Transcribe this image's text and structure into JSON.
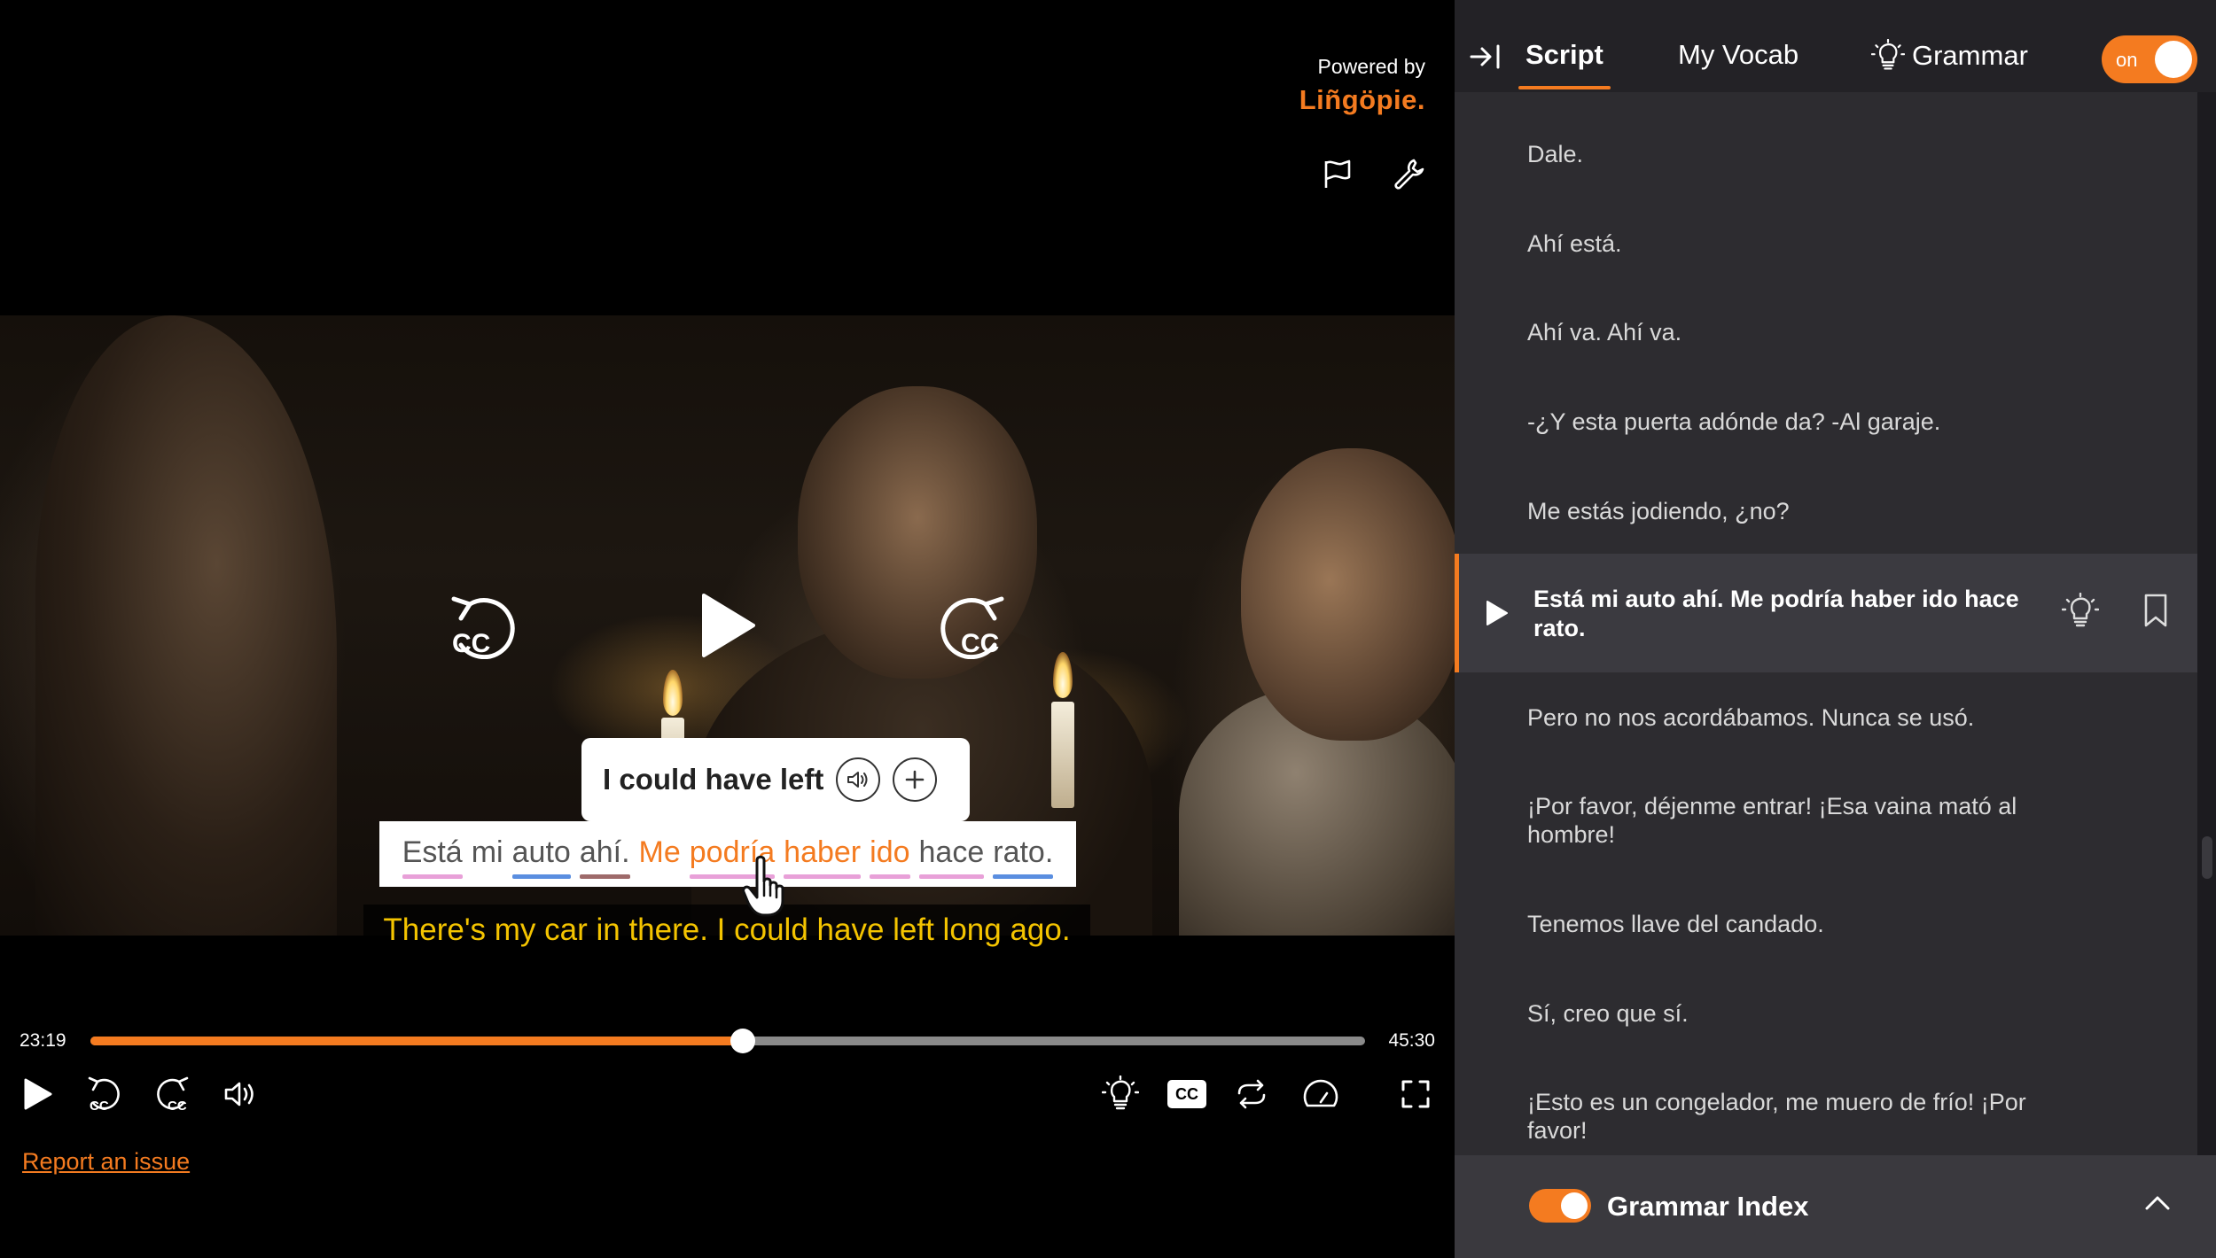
{
  "brand": {
    "powered_by": "Powered by",
    "logo": "Liñgöpie."
  },
  "player": {
    "tooltip": {
      "translation": "I could have left"
    },
    "subtitle_words": [
      {
        "text": "Está",
        "underline": "#e8a0d8",
        "highlight": false
      },
      {
        "text": "mi",
        "underline": null,
        "highlight": false
      },
      {
        "text": "auto",
        "underline": "#5a8ee0",
        "highlight": false
      },
      {
        "text": "ahí.",
        "underline": "#9e6a6a",
        "highlight": false
      },
      {
        "text": "Me",
        "underline": null,
        "highlight": true
      },
      {
        "text": "podría",
        "underline": "#e8a0d8",
        "highlight": true
      },
      {
        "text": "haber",
        "underline": "#e8a0d8",
        "highlight": true
      },
      {
        "text": "ido",
        "underline": "#e8a0d8",
        "highlight": true
      },
      {
        "text": "hace",
        "underline": "#e8a0d8",
        "highlight": false
      },
      {
        "text": "rato.",
        "underline": "#5a8ee0",
        "highlight": false
      }
    ],
    "subtitle_translation": "There's my car in there. I could have left long ago.",
    "time_current": "23:19",
    "time_total": "45:30",
    "progress_fraction": 0.512,
    "report_link": "Report an issue",
    "cc_label": "CC"
  },
  "panel": {
    "tabs": {
      "script": "Script",
      "vocab": "My Vocab",
      "grammar": "Grammar"
    },
    "toggle_label": "on",
    "lines_before": [
      "Dale.",
      "Ahí está.",
      "Ahí va. Ahí va.",
      "-¿Y esta puerta adónde da? -Al garaje.",
      "Me estás jodiendo, ¿no?"
    ],
    "active_line": "Está mi auto ahí. Me podría haber ido hace rato.",
    "lines_after": [
      "Pero no nos acordábamos. Nunca se usó.",
      "¡Por favor, déjenme entrar! ¡Esa vaina mató al hombre!",
      "Tenemos llave del candado.",
      "Sí, creo que sí.",
      "¡Esto es un congelador, me muero de frío! ¡Por favor!"
    ],
    "grammar_index_label": "Grammar Index"
  },
  "colors": {
    "accent": "#f47b20",
    "subtitle_yellow": "#f4c400",
    "panel_bg": "#2d2c30"
  }
}
